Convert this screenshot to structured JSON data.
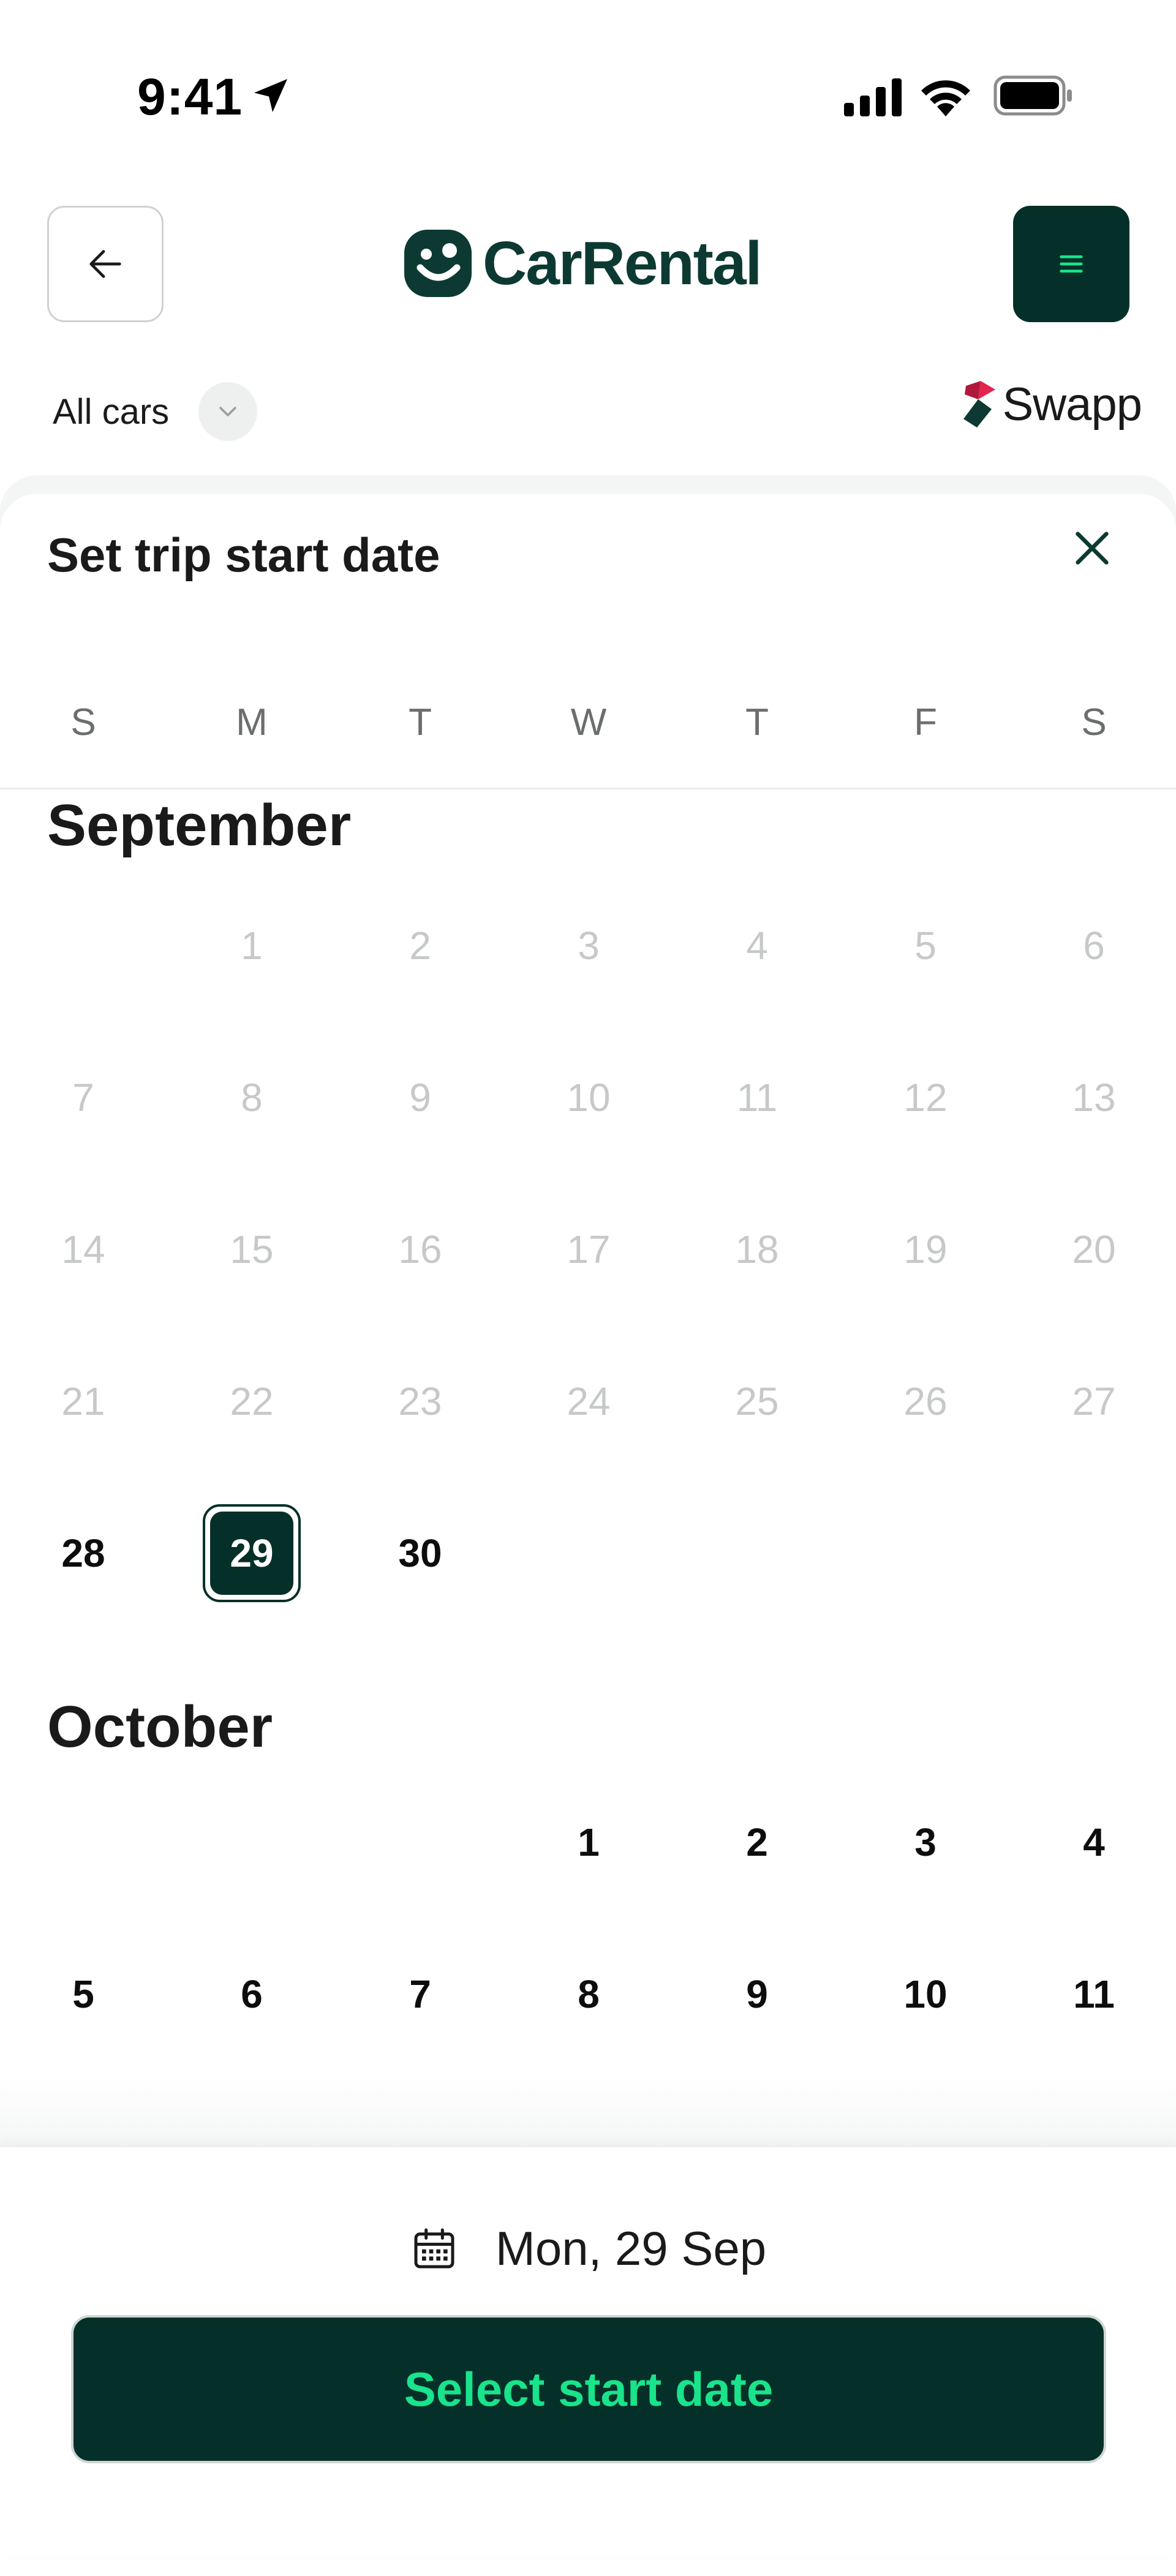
{
  "status_bar": {
    "time": "9:41",
    "icons": [
      "location-arrow-icon",
      "cellular-signal-icon",
      "wifi-icon",
      "battery-icon"
    ]
  },
  "header": {
    "back_icon": "arrow-left-icon",
    "brand": "CarRental",
    "menu_icon": "hamburger-menu-icon",
    "filter_label": "All cars",
    "partner": "Swapp"
  },
  "sheet": {
    "title": "Set trip start date",
    "close_icon": "close-icon"
  },
  "weekdays": [
    "S",
    "M",
    "T",
    "W",
    "T",
    "F",
    "S"
  ],
  "months": [
    {
      "name": "September",
      "first_weekday": 1,
      "days": 30,
      "past_until": 27,
      "selected": 29
    },
    {
      "name": "October",
      "first_weekday": 3,
      "visible_days": 18
    }
  ],
  "bottom": {
    "selected_date": "Mon, 29 Sep",
    "button_label": "Select start date"
  },
  "colors": {
    "brand_dark": "#053029",
    "brand_green": "#19e38b",
    "logo_text": "#0c3a33",
    "past_day": "#c6c9c8"
  }
}
